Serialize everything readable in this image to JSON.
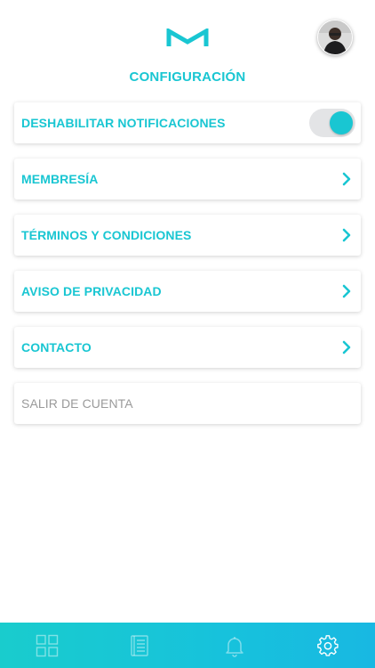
{
  "header": {
    "logo_icon": "m-logo-icon",
    "avatar_icon": "user-avatar",
    "title": "CONFIGURACIÓN"
  },
  "settings": {
    "notifications": {
      "label": "DESHABILITAR NOTIFICACIONES",
      "enabled": true
    },
    "items": [
      {
        "label": "MEMBRESÍA"
      },
      {
        "label": "TÉRMINOS Y CONDICIONES"
      },
      {
        "label": "AVISO DE PRIVACIDAD"
      },
      {
        "label": "CONTACTO"
      }
    ],
    "logout_label": "SALIR DE CUENTA"
  },
  "tabbar": {
    "tabs": [
      {
        "icon": "grid-icon",
        "active": false
      },
      {
        "icon": "document-list-icon",
        "active": false
      },
      {
        "icon": "bell-icon",
        "active": false
      },
      {
        "icon": "gear-icon",
        "active": true
      }
    ]
  },
  "colors": {
    "accent": "#19c6d2",
    "muted_text": "#9a9a9a",
    "toggle_track": "#e3e4e6"
  }
}
